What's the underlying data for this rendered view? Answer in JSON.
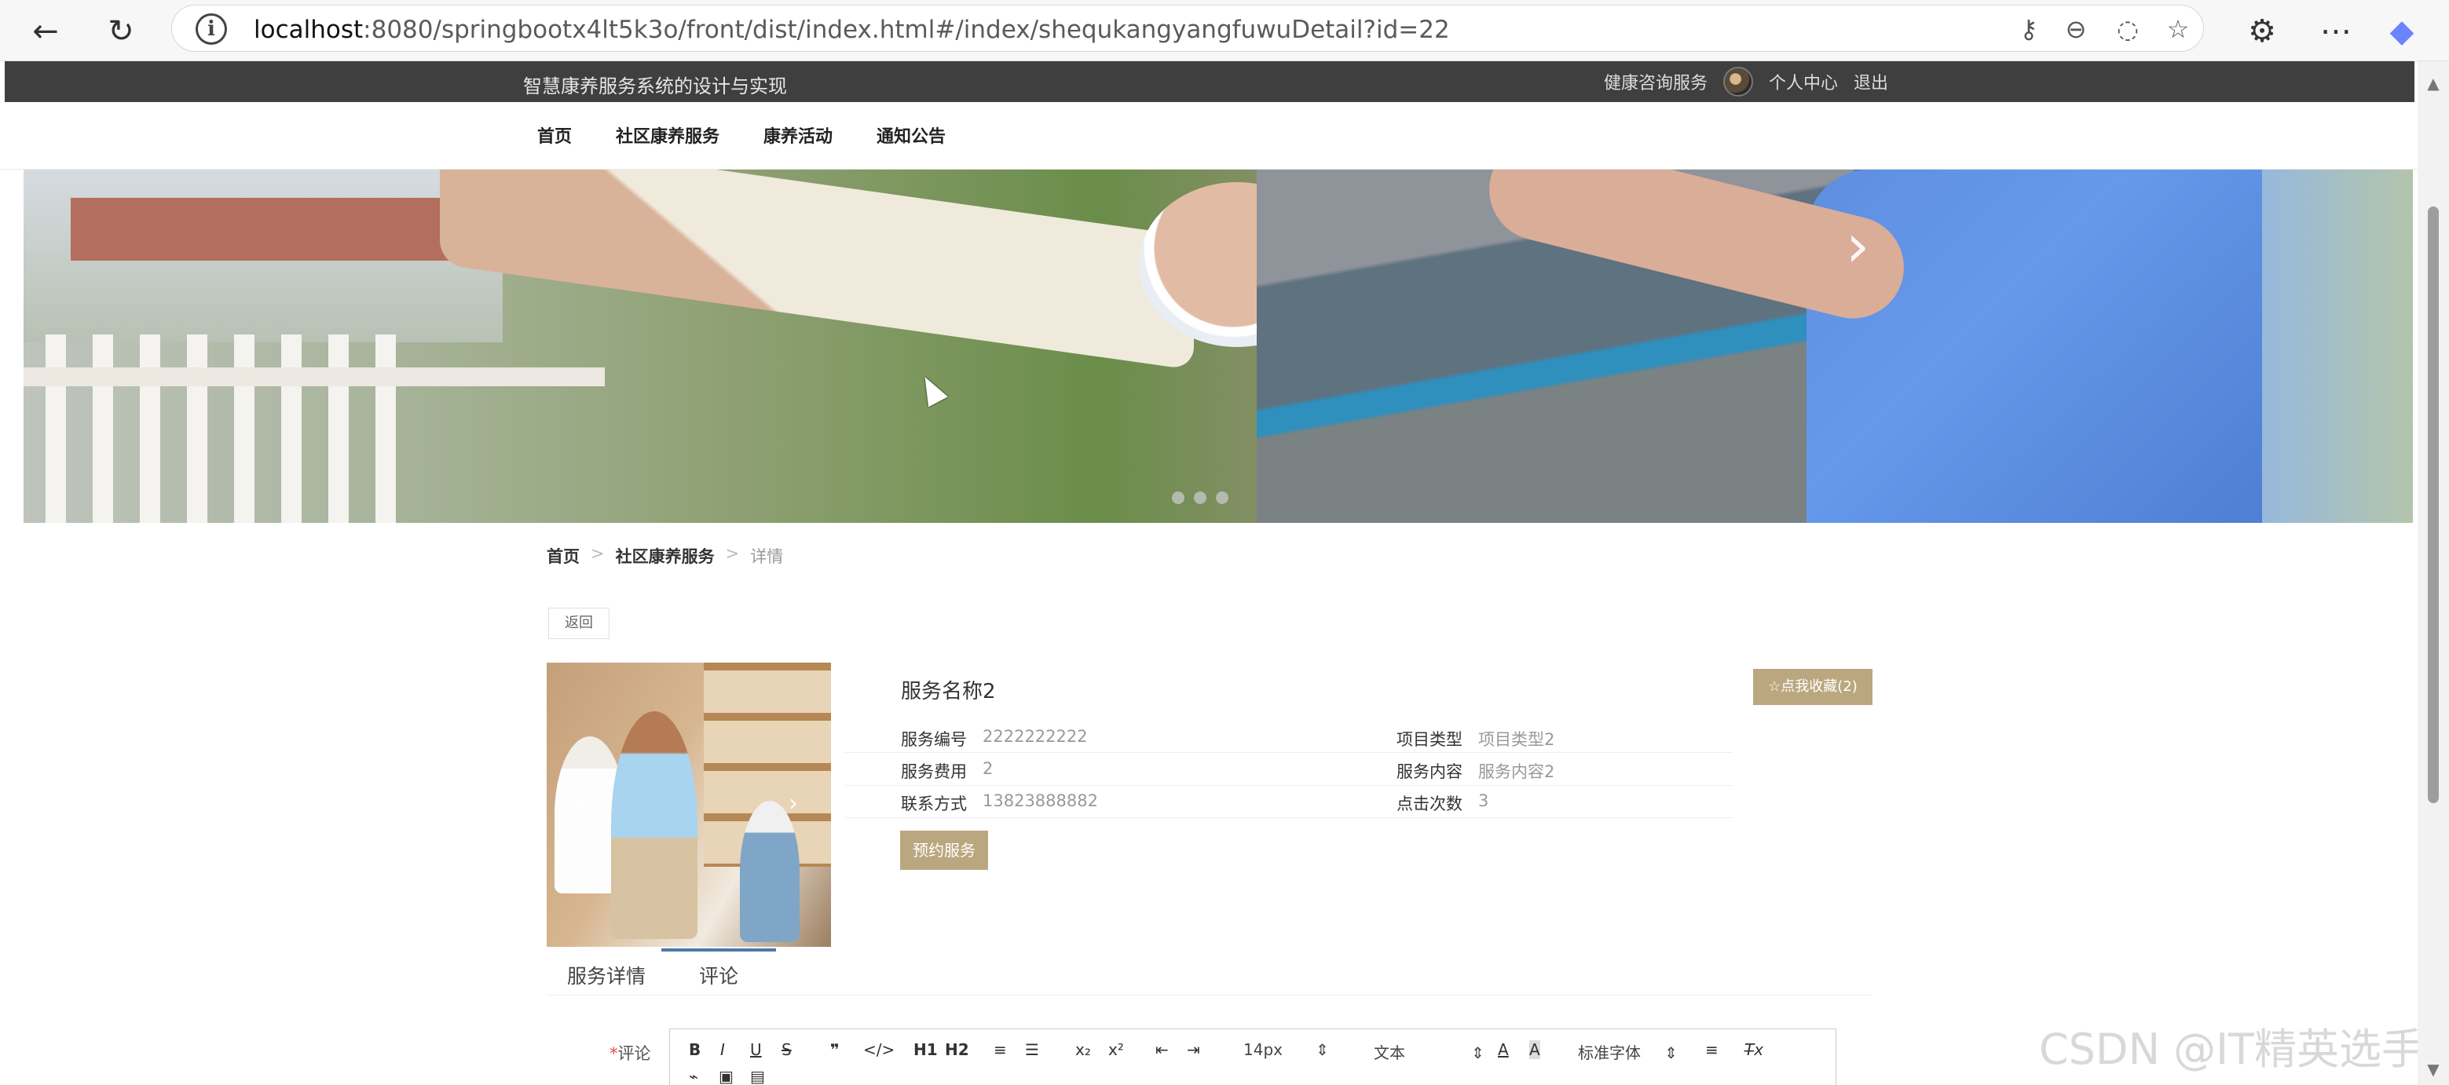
{
  "browser": {
    "url_host": "localhost",
    "url_path": ":8080/springbootx4lt5k3o/front/dist/index.html#/index/shequkangyangfuwuDetail?id=22"
  },
  "site": {
    "title": "智慧康养服务系统的设计与实现",
    "top_links": {
      "consult": "健康咨询服务",
      "personal_center": "个人中心",
      "logout": "退出"
    }
  },
  "nav": {
    "items": [
      {
        "label": "首页"
      },
      {
        "label": "社区康养服务"
      },
      {
        "label": "康养活动"
      },
      {
        "label": "通知公告"
      }
    ]
  },
  "banner": {
    "dots": 3
  },
  "breadcrumb": {
    "home": "首页",
    "section": "社区康养服务",
    "current": "详情",
    "separator": ">"
  },
  "detail": {
    "back": "返回",
    "name": "服务名称2",
    "favorite": "☆点我收藏(2)",
    "fields": {
      "service_no": {
        "label": "服务编号",
        "value": "2222222222"
      },
      "service_fee": {
        "label": "服务费用",
        "value": "2"
      },
      "contact": {
        "label": "联系方式",
        "value": "13823888882"
      },
      "project_type": {
        "label": "项目类型",
        "value": "项目类型2"
      },
      "service_content": {
        "label": "服务内容",
        "value": "服务内容2"
      },
      "click_count": {
        "label": "点击次数",
        "value": "3"
      }
    },
    "book_button": "预约服务"
  },
  "tabs": [
    {
      "label": "服务详情"
    },
    {
      "label": "评论"
    }
  ],
  "comment": {
    "label": "评论",
    "required": "*"
  },
  "editor": {
    "font_size": "14px",
    "text_style": "文本",
    "font_family": "标准字体",
    "heading_1": "H1",
    "heading_2": "H2"
  },
  "watermark": "CSDN @IT精英选手"
}
